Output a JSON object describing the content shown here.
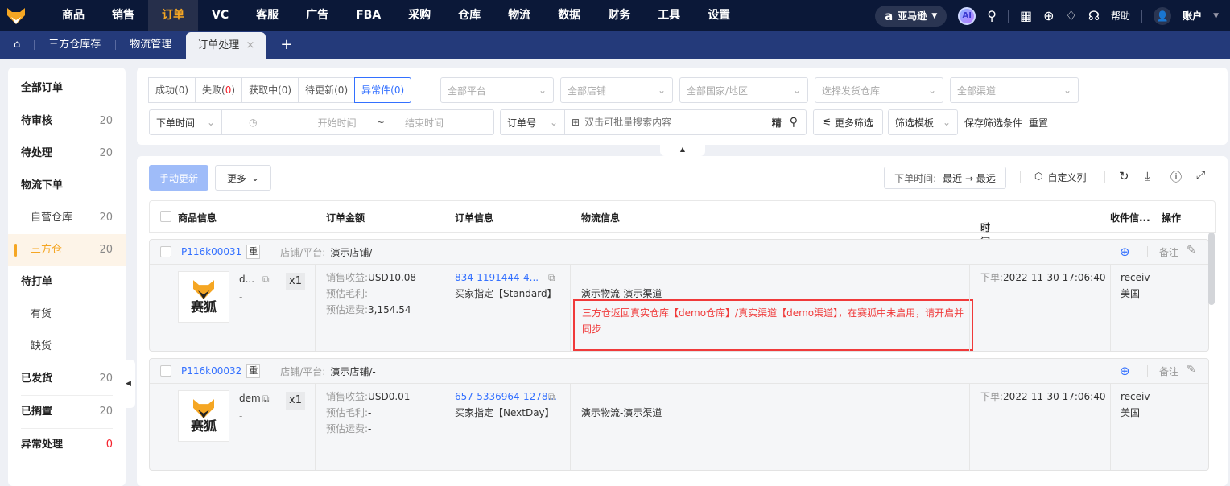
{
  "nav": {
    "items": [
      "商品",
      "销售",
      "订单",
      "VC",
      "客服",
      "广告",
      "FBA",
      "采购",
      "仓库",
      "物流",
      "数据",
      "财务",
      "工具",
      "设置"
    ],
    "active": 2,
    "marketplace": "亚马逊",
    "ai": "AI",
    "help": "帮助",
    "account": "账户"
  },
  "tabs": {
    "items": [
      "三方仓库存",
      "物流管理",
      "订单处理"
    ],
    "active": "订单处理",
    "add": "+",
    "close": "×"
  },
  "sidebar": {
    "items": [
      {
        "label": "全部订单",
        "count": "",
        "type": "h"
      },
      {
        "label": "待审核",
        "count": "20",
        "type": "h"
      },
      {
        "label": "待处理",
        "count": "20",
        "type": "h"
      },
      {
        "label": "物流下单",
        "count": "",
        "type": "h"
      },
      {
        "label": "自营仓库",
        "count": "20",
        "type": "sub"
      },
      {
        "label": "三方仓",
        "count": "20",
        "type": "sub active"
      },
      {
        "label": "待打单",
        "count": "",
        "type": "h"
      },
      {
        "label": "有货",
        "count": "",
        "type": "sub"
      },
      {
        "label": "缺货",
        "count": "",
        "type": "sub"
      },
      {
        "label": "已发货",
        "count": "20",
        "type": "h"
      },
      {
        "label": "已搁置",
        "count": "20",
        "type": "h"
      },
      {
        "label": "异常处理",
        "count": "0",
        "type": "h"
      }
    ]
  },
  "filters": {
    "status": [
      {
        "label": "成功",
        "n": "0"
      },
      {
        "label": "失败",
        "n": "0"
      },
      {
        "label": "获取中",
        "n": "0"
      },
      {
        "label": "待更新",
        "n": "0"
      },
      {
        "label": "异常件",
        "n": "0"
      }
    ],
    "platform": "全部平台",
    "shop": "全部店铺",
    "country": "全部国家/地区",
    "warehouse": "选择发货仓库",
    "channel": "全部渠道",
    "time_type": "下单时间",
    "start": "开始时间",
    "tilde": "~",
    "end": "结束时间",
    "search_type": "订单号",
    "search_placeholder": "双击可批量搜索内容",
    "exact": "精",
    "more": "更多筛选",
    "template": "筛选模板",
    "save": "保存筛选条件",
    "reset": "重置"
  },
  "toolbar": {
    "manual_update": "手动更新",
    "more": "更多",
    "sort_label": "下单时间:",
    "sort_value": "最近 → 最远",
    "custom_cols": "自定义列"
  },
  "table": {
    "headers": [
      "商品信息",
      "订单金额",
      "订单信息",
      "物流信息",
      "时间",
      "收件信...",
      "操作"
    ]
  },
  "orders": [
    {
      "id": "P116k00031",
      "tag": "重",
      "shop_label": "店铺/平台:",
      "shop": "演示店铺/-",
      "product": "d...",
      "sku": "-",
      "qty": "x1",
      "brand": "赛狐",
      "revenue_label": "销售收益:",
      "revenue": "USD10.08",
      "profit_label": "预估毛利:",
      "profit": "-",
      "freight_label": "预估运费:",
      "freight": "3,154.54",
      "order_no": "834-1191444-4...",
      "buyer": "买家指定【Standard】",
      "logistics_1": "-",
      "logistics_2": "演示物流-演示渠道",
      "error": "三方仓返回真实仓库【demo仓库】/真实渠道【demo渠道】，在赛狐中未启用，请开启并同步",
      "time_label": "下单:",
      "time": "2022-11-30 17:06:40",
      "recv": "receive",
      "country": "美国",
      "note": "备注"
    },
    {
      "id": "P116k00032",
      "tag": "重",
      "shop_label": "店铺/平台:",
      "shop": "演示店铺/-",
      "product": "dem...",
      "sku": "-",
      "qty": "x1",
      "brand": "赛狐",
      "revenue_label": "销售收益:",
      "revenue": "USD0.01",
      "profit_label": "预估毛利:",
      "profit": "-",
      "freight_label": "预估运费:",
      "freight": "-",
      "order_no": "657-5336964-1278...",
      "buyer": "买家指定【NextDay】",
      "logistics_1": "-",
      "logistics_2": "演示物流-演示渠道",
      "error": "",
      "time_label": "下单:",
      "time": "2022-11-30 17:06:40",
      "recv": "receive",
      "country": "美国",
      "note": "备注"
    }
  ],
  "colors": {
    "accent": "#f5a623",
    "primary": "#3370ff",
    "error": "#f03a3a",
    "nav_bg": "#0b1838",
    "tab_bg": "#243a7a"
  }
}
